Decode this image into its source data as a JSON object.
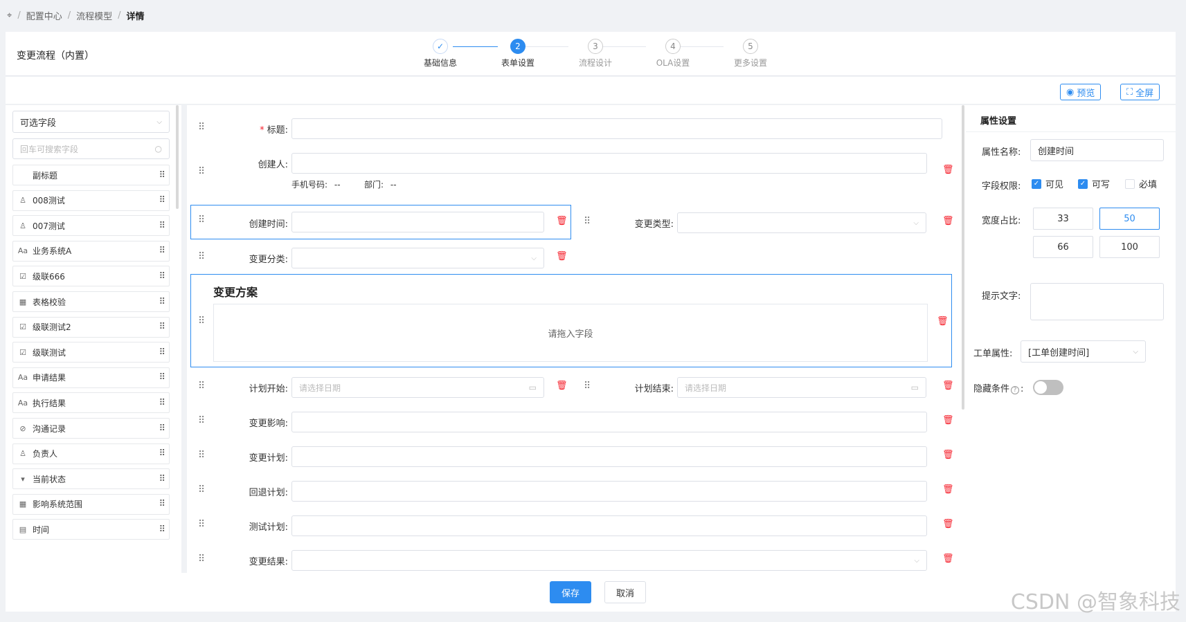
{
  "breadcrumb": {
    "home_icon": "crosshair-icon",
    "items": [
      "配置中心",
      "流程模型"
    ],
    "current": "详情"
  },
  "header": {
    "title": "变更流程（内置）"
  },
  "steps": [
    {
      "number": "✓",
      "label": "基础信息",
      "state": "done"
    },
    {
      "number": "2",
      "label": "表单设置",
      "state": "active"
    },
    {
      "number": "3",
      "label": "流程设计",
      "state": "pending"
    },
    {
      "number": "4",
      "label": "OLA设置",
      "state": "pending"
    },
    {
      "number": "5",
      "label": "更多设置",
      "state": "pending"
    }
  ],
  "toolbar": {
    "preview_label": "预览",
    "fullscreen_label": "全屏"
  },
  "left": {
    "select_value": "可选字段",
    "search_placeholder": "回车可搜索字段",
    "fields": [
      {
        "label": "副标题",
        "icon": ""
      },
      {
        "label": "008测试",
        "icon": "user-icon"
      },
      {
        "label": "007测试",
        "icon": "user-icon"
      },
      {
        "label": "业务系统A",
        "icon": "text-icon"
      },
      {
        "label": "级联666",
        "icon": "checkbox-icon"
      },
      {
        "label": "表格校验",
        "icon": "table-icon"
      },
      {
        "label": "级联测试2",
        "icon": "checkbox-icon"
      },
      {
        "label": "级联测试",
        "icon": "checkbox-icon"
      },
      {
        "label": "申请结果",
        "icon": "text-icon"
      },
      {
        "label": "执行结果",
        "icon": "text-icon"
      },
      {
        "label": "沟通记录",
        "icon": "link-icon"
      },
      {
        "label": "负责人",
        "icon": "user-icon"
      },
      {
        "label": "当前状态",
        "icon": "caret-icon"
      },
      {
        "label": "影响系统范围",
        "icon": "table-icon"
      },
      {
        "label": "时间",
        "icon": "calendar-icon"
      }
    ]
  },
  "form": {
    "title_label": "标题:",
    "creator_label": "创建人:",
    "phone_label": "手机号码:",
    "phone_value": "--",
    "dept_label": "部门:",
    "dept_value": "--",
    "create_time_label": "创建时间:",
    "change_type_label": "变更类型:",
    "change_category_label": "变更分类:",
    "plan_section_title": "变更方案",
    "drop_hint": "请拖入字段",
    "plan_start_label": "计划开始:",
    "plan_end_label": "计划结束:",
    "date_placeholder": "请选择日期",
    "impact_label": "变更影响:",
    "plan_label": "变更计划:",
    "rollback_label": "回退计划:",
    "test_label": "测试计划:",
    "result_label": "变更结果:"
  },
  "props": {
    "title": "属性设置",
    "name_label": "属性名称:",
    "name_value": "创建时间",
    "perm_label": "字段权限:",
    "visible_label": "可见",
    "writable_label": "可写",
    "required_label": "必填",
    "width_label": "宽度占比:",
    "widths": [
      "33",
      "50",
      "66",
      "100"
    ],
    "width_selected": "50",
    "hint_label": "提示文字:",
    "ticket_attr_label": "工单属性:",
    "ticket_attr_value": "[工单创建时间]",
    "hide_cond_label": "隐藏条件",
    "hide_cond_help": "?",
    "hide_cond_on": false
  },
  "footer": {
    "save_label": "保存",
    "cancel_label": "取消"
  },
  "watermark": "CSDN @智象科技"
}
